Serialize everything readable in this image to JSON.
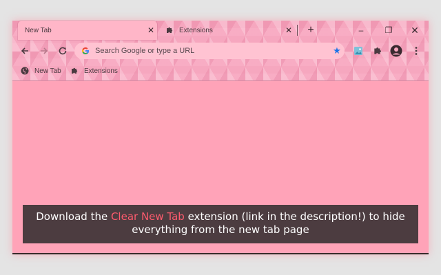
{
  "tabs": [
    {
      "label": "New Tab",
      "active": true
    },
    {
      "label": "Extensions",
      "active": false
    }
  ],
  "new_tab_symbol": "+",
  "close_symbol": "✕",
  "window_controls": {
    "minimize": "–",
    "restore": "❐",
    "close": "✕"
  },
  "toolbar": {
    "back": "back-arrow-icon",
    "forward": "forward-arrow-icon",
    "reload": "reload-icon"
  },
  "omnibox": {
    "placeholder": "Search Google or type a URL",
    "star": "★"
  },
  "bookmarks": [
    {
      "label": "New Tab",
      "icon": "globe-icon"
    },
    {
      "label": "Extensions",
      "icon": "puzzle-icon"
    }
  ],
  "banner": {
    "text_before": "Download the ",
    "highlight": "Clear New Tab",
    "text_after": " extension (link in the description!) to hide everything from the new tab page"
  },
  "colors": {
    "page_background": "#ffa3b8",
    "banner_background": "#4c3c40",
    "banner_highlight": "#ff5b6e",
    "star_blue": "#1a73e8"
  }
}
